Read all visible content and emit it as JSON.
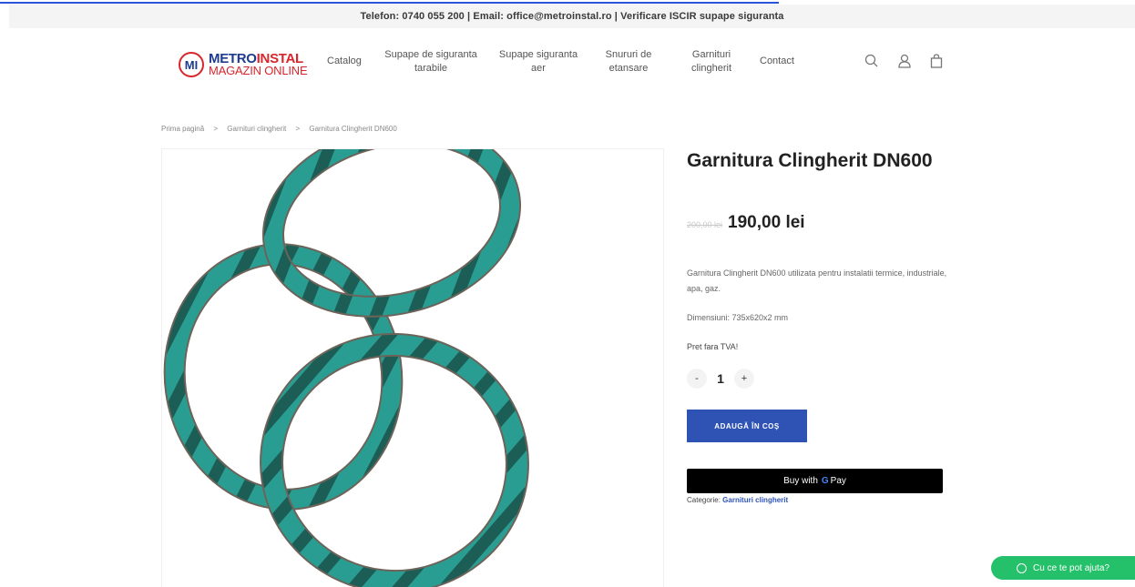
{
  "topbar": {
    "text": "Telefon: 0740 055 200 | Email: office@metroinstal.ro | Verificare ISCIR supape siguranta"
  },
  "logo": {
    "mark": "MI",
    "line1_a": "METRO",
    "line1_b": "INSTAL",
    "line2": "MAGAZIN ONLINE"
  },
  "nav": {
    "catalog": "Catalog",
    "supape_tarabile_1": "Supape de siguranta",
    "supape_tarabile_2": "tarabile",
    "supape_aer_1": "Supape siguranta",
    "supape_aer_2": "aer",
    "snururi_1": "Snururi de",
    "snururi_2": "etansare",
    "garnituri_1": "Garnituri",
    "garnituri_2": "clingherit",
    "contact": "Contact"
  },
  "header_icons": [
    "search-icon",
    "user-icon",
    "cart-bag-icon"
  ],
  "breadcrumb": {
    "home": "Prima pagină",
    "sep": ">",
    "category": "Garnituri clingherit",
    "current": "Garnitura Clingherit DN600"
  },
  "product": {
    "title": "Garnitura Clingherit DN600",
    "old_price": "200,00 lei",
    "price": "190,00 lei",
    "description": "Garnitura Clingherit DN600  utilizata pentru instalatii termice, industriale, apa, gaz.",
    "dimensions": "Dimensiuni: 735x620x2 mm",
    "vat_note": "Pret fara TVA!",
    "quantity": "1",
    "minus": "-",
    "plus": "+",
    "add_to_cart": "ADAUGĂ ÎN COȘ",
    "gpay_prefix": "Buy with",
    "gpay_g": "G",
    "gpay_suffix": "Pay",
    "category_label": "Categorie:",
    "category_value": "Garnituri clingherit"
  },
  "whatsapp": {
    "label": "Cu ce te pot ajuta?"
  },
  "colors": {
    "accent": "#2f53b5",
    "gasket": "#2a9d92",
    "whatsapp": "#25c16a"
  }
}
